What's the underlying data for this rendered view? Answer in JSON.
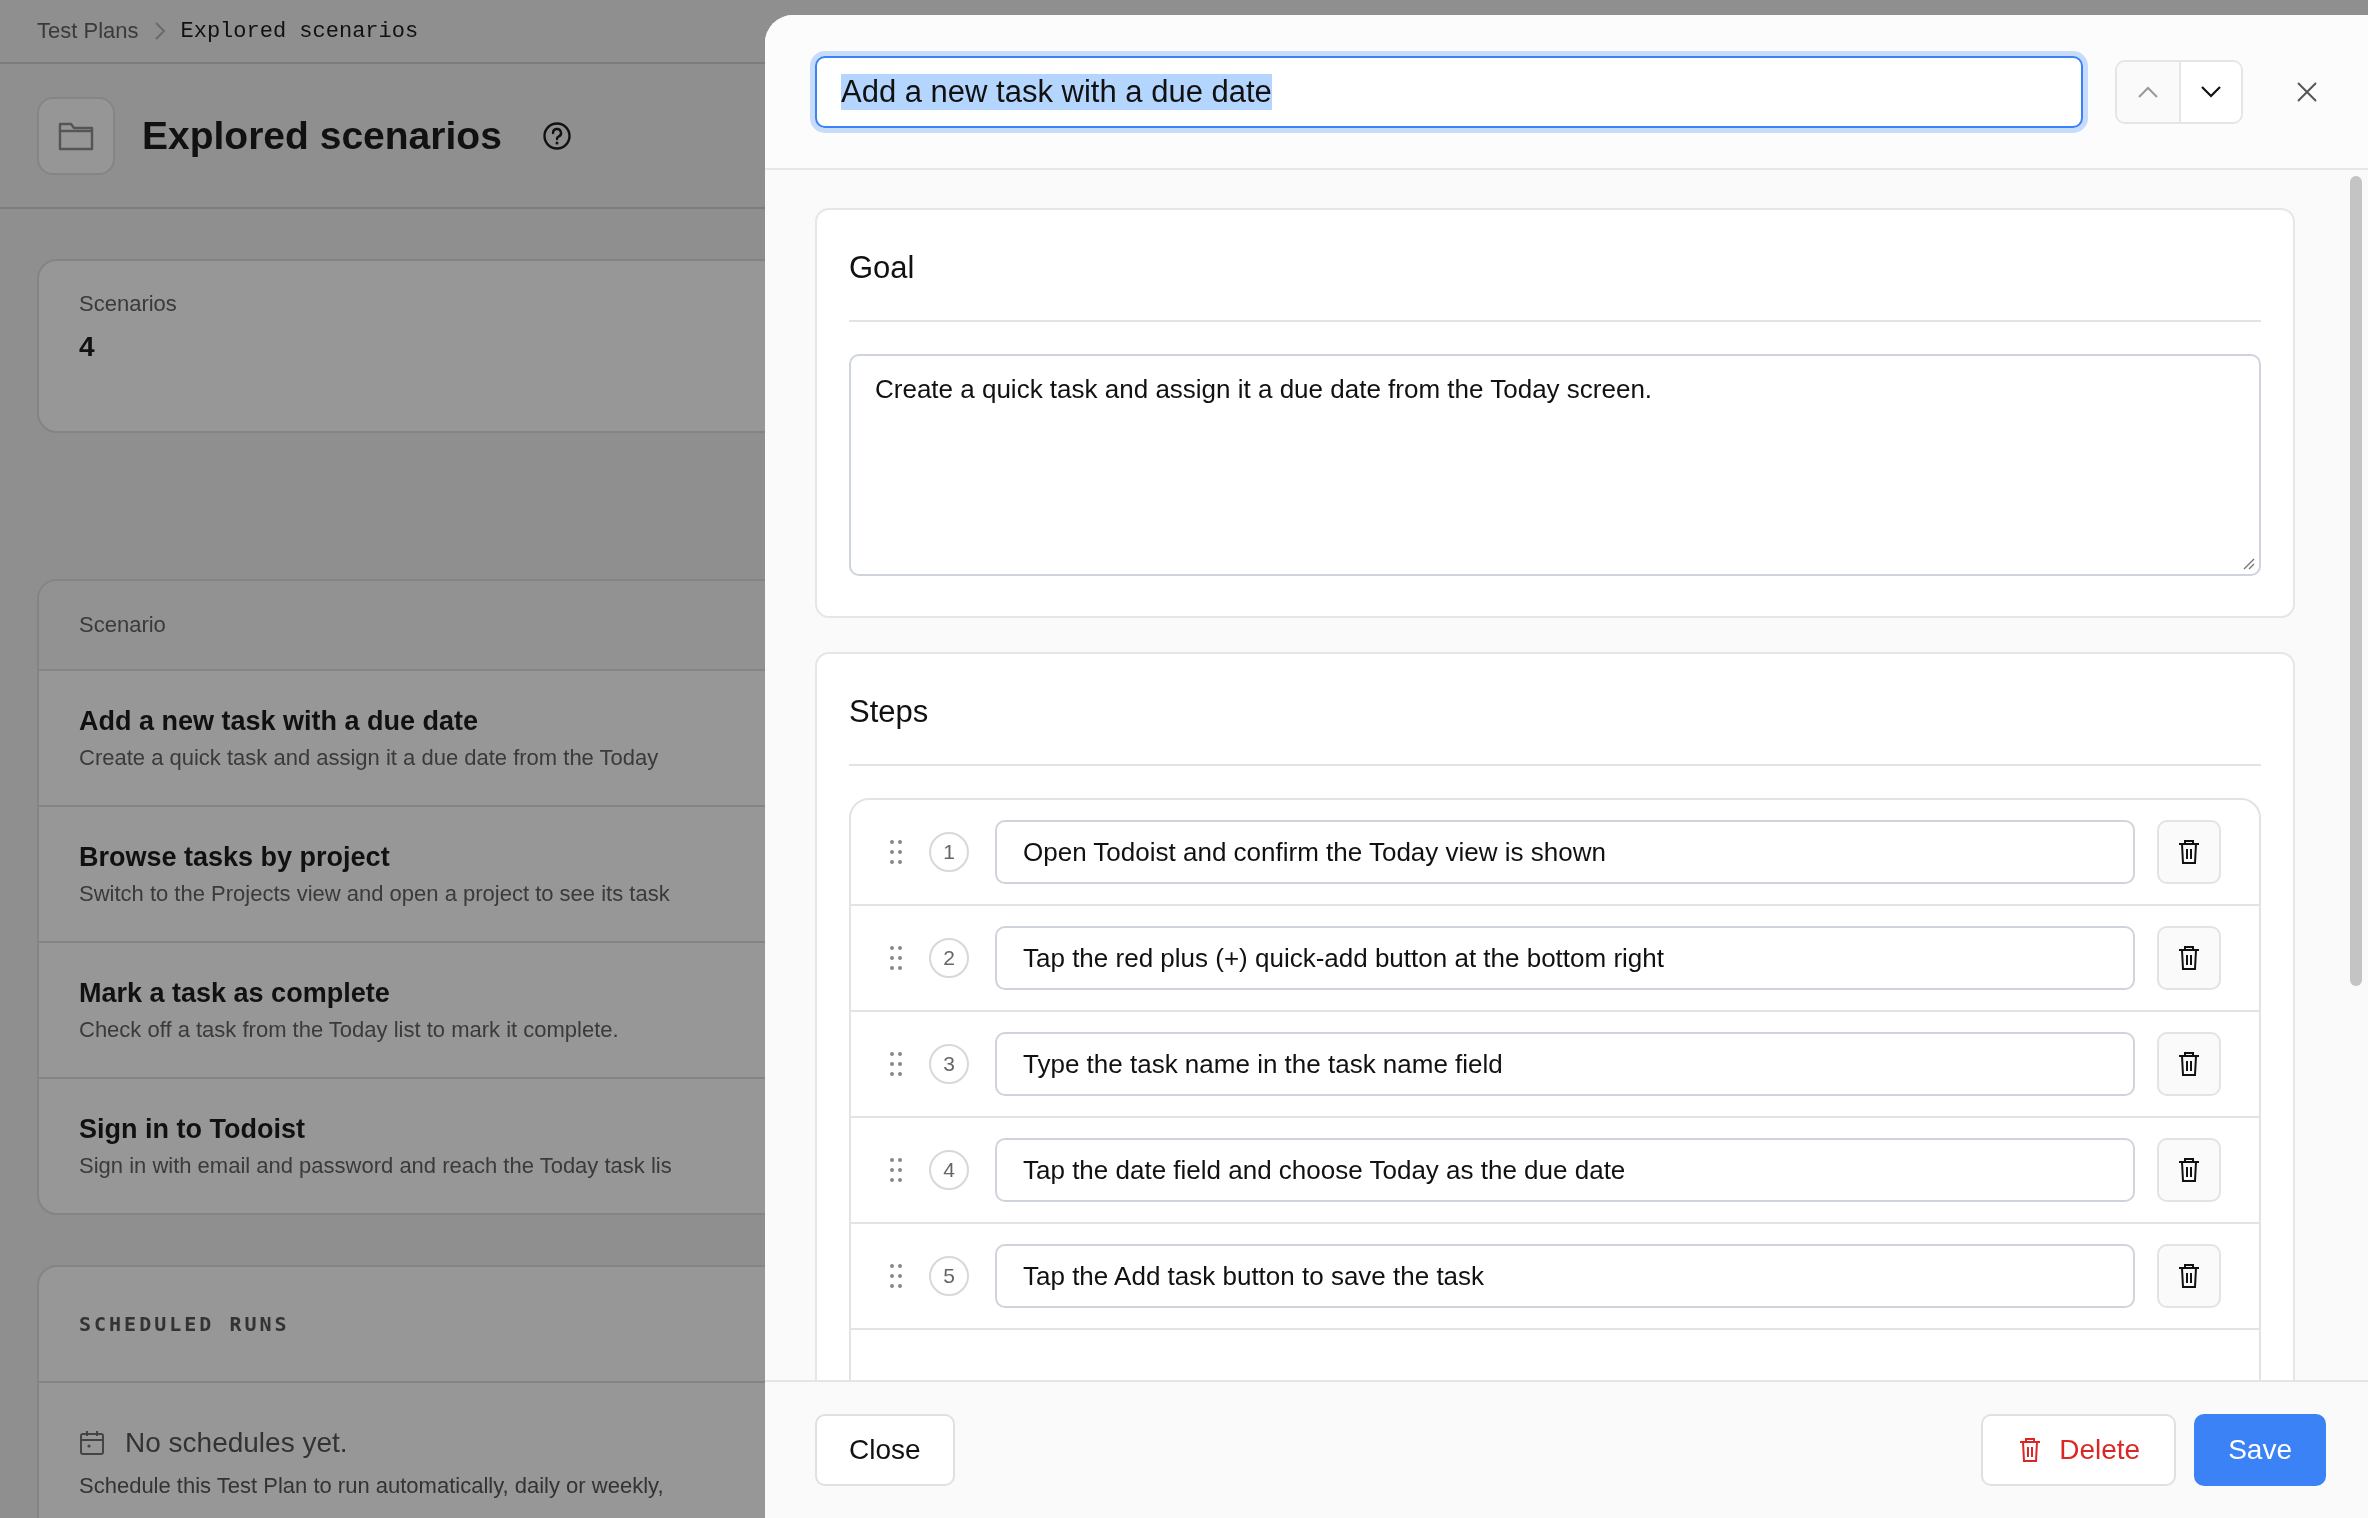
{
  "breadcrumb": {
    "items": [
      "Test Plans"
    ],
    "current": "Explored scenarios"
  },
  "header": {
    "title": "Explored scenarios"
  },
  "stats": {
    "label": "Scenarios",
    "value": "4"
  },
  "scenarios": {
    "column": "Scenario",
    "rows": [
      {
        "title": "Add a new task with a due date",
        "description": "Create a quick task and assign it a due date from the Today"
      },
      {
        "title": "Browse tasks by project",
        "description": "Switch to the Projects view and open a project to see its task"
      },
      {
        "title": "Mark a task as complete",
        "description": "Check off a task from the Today list to mark it complete."
      },
      {
        "title": "Sign in to Todoist",
        "description": "Sign in with email and password and reach the Today task lis"
      }
    ]
  },
  "scheduled_runs": {
    "title": "SCHEDULED RUNS",
    "empty_title": "No schedules yet.",
    "empty_text": "Schedule this Test Plan to run automatically, daily or weekly,"
  },
  "modal": {
    "title_value": "Add a new task with a due date",
    "title_selected": true,
    "goal": {
      "heading": "Goal",
      "value": "Create a quick task and assign it a due date from the Today screen."
    },
    "steps": {
      "heading": "Steps",
      "items": [
        {
          "number": "1",
          "text": "Open Todoist and confirm the Today view is shown"
        },
        {
          "number": "2",
          "text": "Tap the red plus (+) quick-add button at the bottom right"
        },
        {
          "number": "3",
          "text": "Type the task name in the task name field"
        },
        {
          "number": "4",
          "text": "Tap the date field and choose Today as the due date"
        },
        {
          "number": "5",
          "text": "Tap the Add task button to save the task"
        }
      ]
    },
    "buttons": {
      "close": "Close",
      "delete": "Delete",
      "save": "Save"
    }
  }
}
